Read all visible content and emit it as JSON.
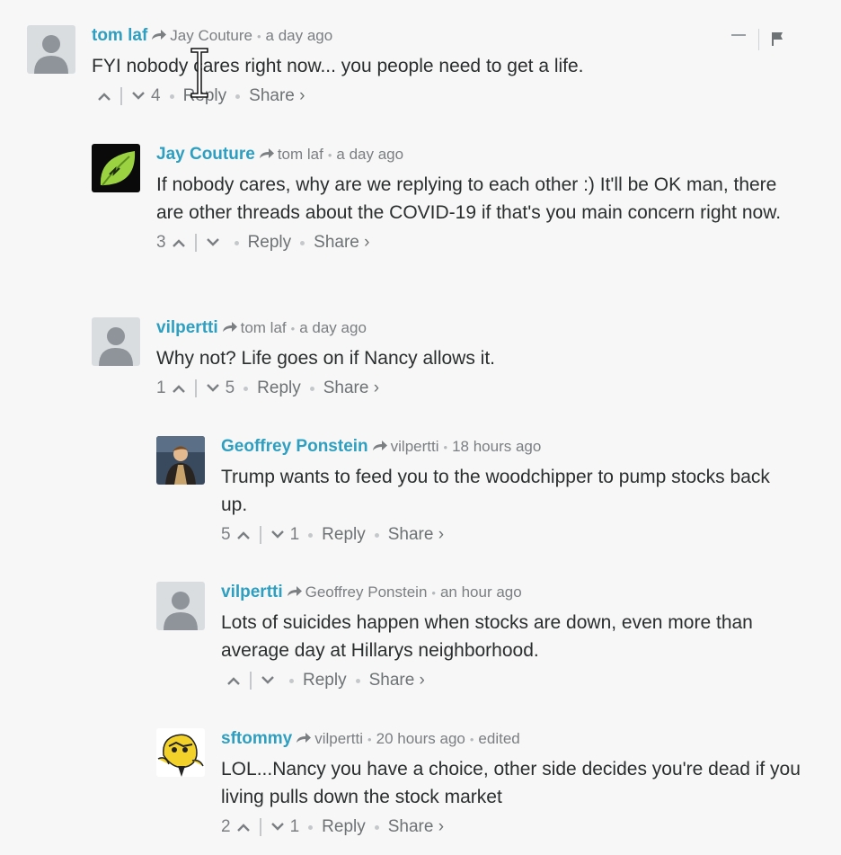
{
  "actions": {
    "reply_label": "Reply",
    "share_label": "Share ›"
  },
  "comments": [
    {
      "author": "tom laf",
      "parent": "Jay Couture",
      "time": "a day ago",
      "edited": "",
      "text": "FYI nobody cares right now... you people need to get a life.",
      "upvotes": "",
      "downvotes": "4",
      "avatar": "default-avatar-icon"
    },
    {
      "author": "Jay Couture",
      "parent": "tom laf",
      "time": "a day ago",
      "edited": "",
      "text": "If nobody cares, why are we replying to each other :) It'll be OK man, there are other threads about the COVID-19 if that's you main concern right now.",
      "upvotes": "3",
      "downvotes": "",
      "avatar": "green-leaf-avatar-icon"
    },
    {
      "author": "vilpertti",
      "parent": "tom laf",
      "time": "a day ago",
      "edited": "",
      "text": "Why not? Life goes on if Nancy allows it.",
      "upvotes": "1",
      "downvotes": "5",
      "avatar": "default-avatar-icon"
    },
    {
      "author": "Geoffrey Ponstein",
      "parent": "vilpertti",
      "time": "18 hours ago",
      "edited": "",
      "text": "Trump wants to feed you to the woodchipper to pump stocks back up.",
      "upvotes": "5",
      "downvotes": "1",
      "avatar": "photo-avatar-icon"
    },
    {
      "author": "vilpertti",
      "parent": "Geoffrey Ponstein",
      "time": "an hour ago",
      "edited": "",
      "text": "Lots of suicides happen when stocks are down, even more than average day at Hillarys neighborhood.",
      "upvotes": "",
      "downvotes": "",
      "avatar": "default-avatar-icon"
    },
    {
      "author": "sftommy",
      "parent": "vilpertti",
      "time": "20 hours ago",
      "edited": "edited",
      "text": "LOL...Nancy you have a choice, other side decides you're dead if you living pulls down the stock market",
      "upvotes": "2",
      "downvotes": "1",
      "avatar": "cartoon-avatar-icon"
    }
  ],
  "colors": {
    "author": "#2e9fc0",
    "meta": "#7b7f82",
    "text": "#2a2e2e",
    "background": "#f7f7f7"
  }
}
